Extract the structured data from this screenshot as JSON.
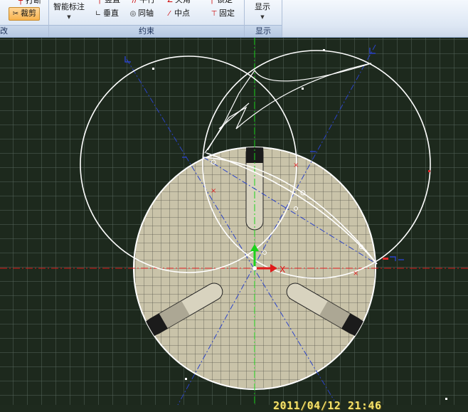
{
  "ribbon": {
    "edit_panel": {
      "partial_label": "打断",
      "trim_label": "裁剪",
      "footer_partial": "改"
    },
    "constraint_panel": {
      "smart_dim_label": "智能标注",
      "top_row_partial": [
        "竖直",
        "平行",
        "夹角",
        "锁定"
      ],
      "perpendicular_label": "垂直",
      "coaxial_label": "同轴",
      "midpoint_label": "中点",
      "fixed_label": "固定",
      "footer": "约束"
    },
    "display_panel": {
      "display_label": "显示",
      "footer": "显示"
    }
  },
  "canvas": {
    "x_axis_label": "X",
    "timestamp": "2011/04/12  21:46"
  }
}
